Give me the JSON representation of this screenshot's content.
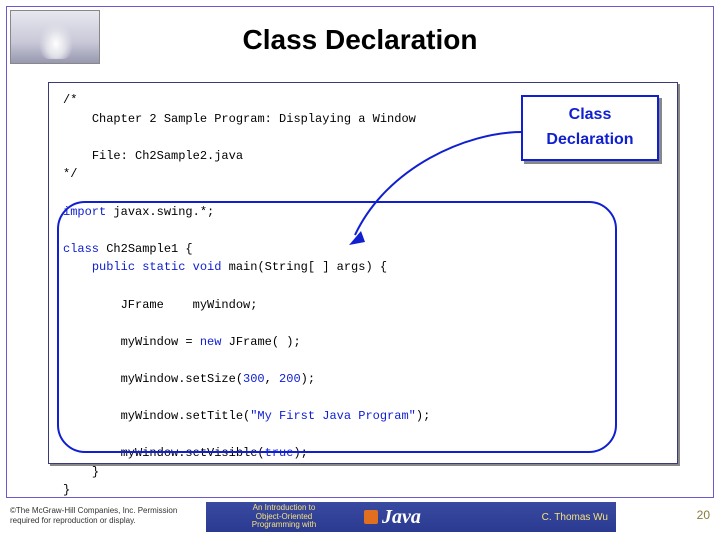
{
  "title": "Class Declaration",
  "callout": {
    "line1": "Class",
    "line2": "Declaration"
  },
  "code": {
    "c_open": "/*",
    "c_line1": "Chapter 2 Sample Program: Displaying a Window",
    "c_line2": "File: Ch2Sample2.java",
    "c_close": "*/",
    "kw_import": "import",
    "import_rest": " javax.swing.*;",
    "kw_class": "class",
    "class_rest": " Ch2Sample1 {",
    "kw_public_static_void": "public static void",
    "main_rest": " main(String[ ] args) {",
    "jframe_decl": "JFrame    myWindow;",
    "assign1": "myWindow = ",
    "kw_new": "new",
    "assign2": " JFrame( );",
    "setsize1": "myWindow.setSize(",
    "num300": "300",
    "comma": ", ",
    "num200": "200",
    "setsize2": ");",
    "settitle1": "myWindow.setTitle(",
    "title_str": "\"My First Java Program\"",
    "settitle2": ");",
    "setvis1": "myWindow.setVisible(",
    "kw_true": "true",
    "setvis2": ");",
    "brace_close_inner": "}",
    "brace_close_outer": "}"
  },
  "footer": {
    "copyright": "©The McGraw-Hill Companies, Inc. Permission required for reproduction or display.",
    "banner_intro1": "An Introduction to",
    "banner_intro2": "Object-Oriented",
    "banner_intro3": "Programming with",
    "banner_java": "Java",
    "banner_author": "C. Thomas Wu",
    "page": "20"
  }
}
